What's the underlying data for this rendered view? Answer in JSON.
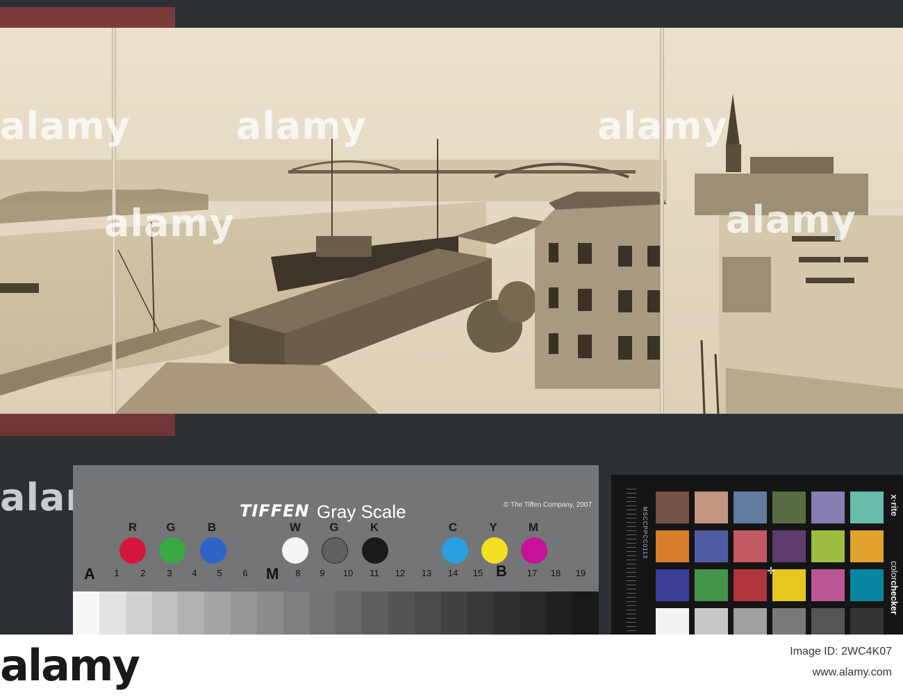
{
  "watermark": "alamy",
  "tiffen_card": {
    "brand": "TIFFEN",
    "title": "Gray Scale",
    "copyright": "© The Tiffen Company, 2007",
    "color_letters": [
      "R",
      "G",
      "B",
      "W",
      "G",
      "K",
      "C",
      "Y",
      "M"
    ],
    "dot_colors": [
      "#d5173d",
      "#3aa845",
      "#2f63c5",
      "#f4f4f4",
      "#5f6163",
      "#1a1a1a",
      "#2aa0e0",
      "#f2e020",
      "#c8109a"
    ],
    "scale_letters": [
      "A",
      "M",
      "B"
    ],
    "scale_numbers": [
      "1",
      "2",
      "3",
      "4",
      "5",
      "6",
      "8",
      "9",
      "10",
      "11",
      "12",
      "13",
      "14",
      "15",
      "17",
      "18",
      "19"
    ],
    "gray_steps": [
      "#f7f7f7",
      "#e3e3e3",
      "#d1d1d1",
      "#c1c1c1",
      "#b2b2b2",
      "#a4a4a4",
      "#979797",
      "#8b8b8b",
      "#7f7f7f",
      "#737373",
      "#686868",
      "#5e5e5e",
      "#545454",
      "#4a4a4a",
      "#414141",
      "#383838",
      "#303030",
      "#282828",
      "#202020",
      "#181818"
    ]
  },
  "color_checker": {
    "brand": "x·rite",
    "label_prefix": "color",
    "label_bold": "checker",
    "ruler_label": "MSCCPPCC0113",
    "patches": [
      [
        "#735244",
        "#c29682",
        "#627a9d",
        "#576c43",
        "#8580b1",
        "#67bdaa"
      ],
      [
        "#d67e2c",
        "#505ba6",
        "#c15a63",
        "#5e3c6c",
        "#9dbc40",
        "#e0a32e"
      ],
      [
        "#383d96",
        "#469449",
        "#af363c",
        "#e7c71f",
        "#bb5695",
        "#0885a1"
      ],
      [
        "#f3f3f2",
        "#c8c8c8",
        "#a0a0a0",
        "#7a7a79",
        "#555555",
        "#343434"
      ]
    ]
  },
  "banner": {
    "logo": "alamy",
    "image_id": "Image ID: 2WC4K07",
    "site": "www.alamy.com"
  },
  "colors": {
    "album_cover": "#7a3a3a",
    "photo_paper": "#e2d6bf",
    "background": "#2c3035"
  }
}
